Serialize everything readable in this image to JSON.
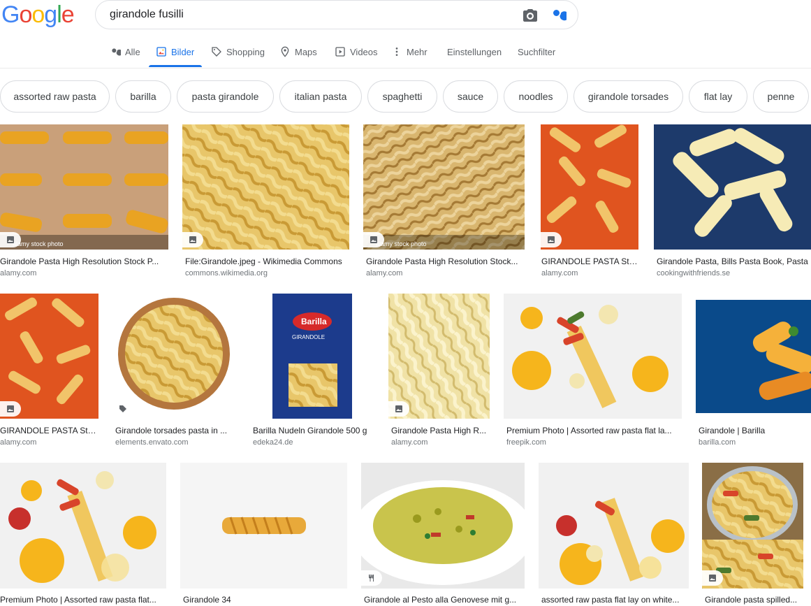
{
  "header": {
    "logo": [
      "G",
      "o",
      "o",
      "g",
      "l",
      "e"
    ],
    "logo_colors": [
      "#4285f4",
      "#ea4335",
      "#fbbc05",
      "#4285f4",
      "#34a853",
      "#ea4335"
    ],
    "query": "girandole fusilli"
  },
  "tabs": {
    "all": "Alle",
    "images": "Bilder",
    "shopping": "Shopping",
    "maps": "Maps",
    "videos": "Videos",
    "more": "Mehr",
    "settings": "Einstellungen",
    "tools": "Suchfilter"
  },
  "chips": [
    "assorted raw pasta",
    "barilla",
    "pasta girandole",
    "italian pasta",
    "spaghetti",
    "sauce",
    "noodles",
    "girandole torsades",
    "flat lay",
    "penne"
  ],
  "results": [
    {
      "title": "Girandole Pasta High Resolution Stock P...",
      "source": "alamy.com",
      "watermark": "alamy stock photo"
    },
    {
      "title": "File:Girandole.jpeg - Wikimedia Commons",
      "source": "commons.wikimedia.org"
    },
    {
      "title": "Girandole Pasta High Resolution Stock...",
      "source": "alamy.com",
      "watermark": "alamy stock photo"
    },
    {
      "title": "GIRANDOLE PASTA Sto...",
      "source": "alamy.com"
    },
    {
      "title": "Girandole Pasta, Bills Pasta Book, Pasta",
      "source": "cookingwithfriends.se"
    },
    {
      "title": "GIRANDOLE PASTA Sto...",
      "source": "alamy.com"
    },
    {
      "title": "Girandole torsades pasta in ...",
      "source": "elements.envato.com"
    },
    {
      "title": "Barilla Nudeln Girandole 500 g",
      "source": "edeka24.de",
      "pack_brand": "Barilla",
      "pack_name": "GIRANDOLE"
    },
    {
      "title": "Girandole Pasta High R...",
      "source": "alamy.com"
    },
    {
      "title": "Premium Photo | Assorted raw pasta flat la...",
      "source": "freepik.com"
    },
    {
      "title": "Girandole | Barilla",
      "source": "barilla.com"
    },
    {
      "title": "Premium Photo | Assorted raw pasta flat...",
      "source": ""
    },
    {
      "title": "Girandole 34",
      "source": ""
    },
    {
      "title": "Girandole al Pesto alla Genovese mit g...",
      "source": ""
    },
    {
      "title": "assorted raw pasta flat lay on white...",
      "source": ""
    },
    {
      "title": "Girandole pasta spilled...",
      "source": ""
    }
  ]
}
